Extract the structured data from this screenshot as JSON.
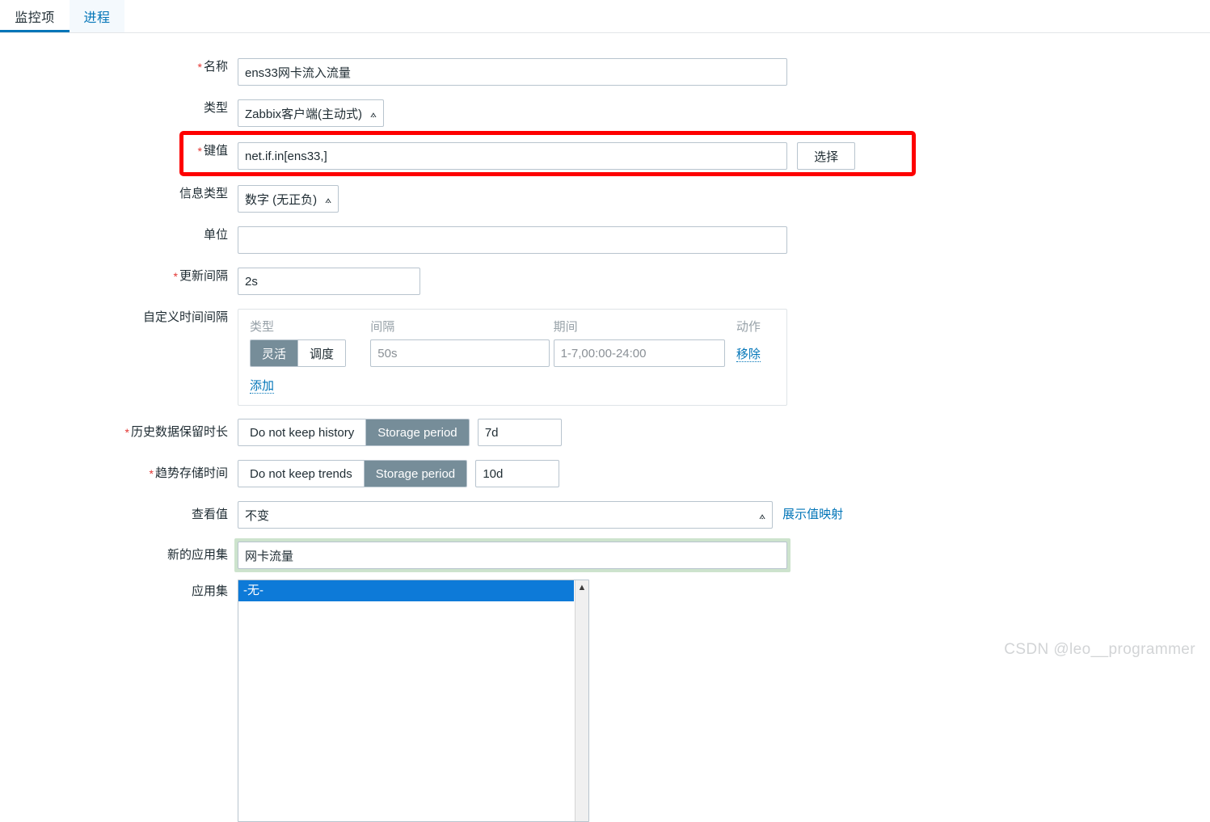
{
  "tabs": [
    {
      "label": "监控项",
      "active": true
    },
    {
      "label": "进程",
      "active": false
    }
  ],
  "colors": {
    "accent": "#0275b8",
    "required_star": "#e33734",
    "toggle_selected_bg": "#768d99",
    "annotation_box": "#fe0000",
    "focus_ring_green": "#cde3cd",
    "listbox_selection": "#0d7ad8"
  },
  "form": {
    "name": {
      "label": "名称",
      "required": true,
      "value": "ens33网卡流入流量"
    },
    "type": {
      "label": "类型",
      "required": false,
      "value": "Zabbix客户端(主动式)"
    },
    "key": {
      "label": "键值",
      "required": true,
      "value": "net.if.in[ens33,]",
      "select_button": "选择"
    },
    "value_type": {
      "label": "信息类型",
      "required": false,
      "value": "数字 (无正负)"
    },
    "units": {
      "label": "单位",
      "required": false,
      "value": "",
      "placeholder": ""
    },
    "update_interval": {
      "label": "更新间隔",
      "required": true,
      "value": "2s"
    },
    "custom_intervals": {
      "label": "自定义时间间隔",
      "required": false,
      "headers": {
        "type": "类型",
        "interval": "间隔",
        "period": "期间",
        "action": "动作"
      },
      "rows": [
        {
          "type_flexible": "灵活",
          "type_scheduling": "调度",
          "type_selected": "灵活",
          "interval_value": "",
          "interval_placeholder": "50s",
          "period_value": "",
          "period_placeholder": "1-7,00:00-24:00",
          "action_label": "移除"
        }
      ],
      "add_label": "添加"
    },
    "history": {
      "label": "历史数据保留时长",
      "required": true,
      "option_off": "Do not keep history",
      "option_on": "Storage period",
      "selected": "Storage period",
      "value": "7d"
    },
    "trends": {
      "label": "趋势存储时间",
      "required": true,
      "option_off": "Do not keep trends",
      "option_on": "Storage period",
      "selected": "Storage period",
      "value": "10d"
    },
    "show_value": {
      "label": "查看值",
      "required": false,
      "value": "不变",
      "link_label": "展示值映射"
    },
    "new_application": {
      "label": "新的应用集",
      "required": false,
      "value": "网卡流量",
      "focused": true
    },
    "applications": {
      "label": "应用集",
      "required": false,
      "options": [
        "-无-"
      ],
      "selected": "-无-"
    }
  },
  "watermark": "CSDN @leo__programmer"
}
